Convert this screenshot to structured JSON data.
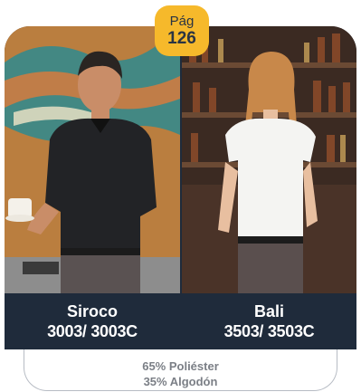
{
  "badge": {
    "label": "Pág",
    "number": "126"
  },
  "products": [
    {
      "name": "Siroco",
      "code": "3003/ 3003C"
    },
    {
      "name": "Bali",
      "code": "3503/ 3503C"
    }
  ],
  "fabric": {
    "line1": "65% Poliéster",
    "line2": "35% Algodón"
  },
  "colors": {
    "accent": "#f6b92b",
    "label_bg": "#1f2b3b",
    "text_gray": "#7b7f86"
  }
}
